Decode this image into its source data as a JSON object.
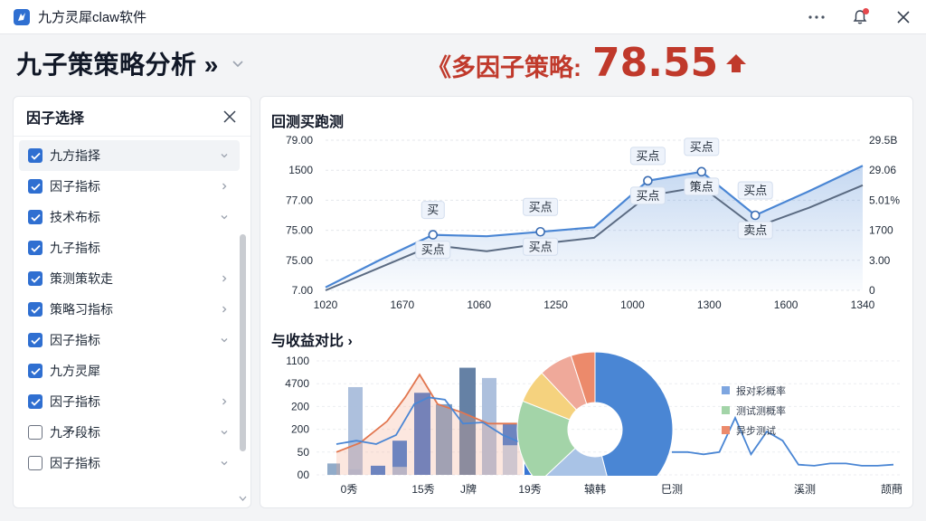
{
  "window": {
    "title": "九方灵犀claw软件"
  },
  "header": {
    "title": "九子策策略分析 »",
    "score_label": "《多因子策略:",
    "score_value": "78.55"
  },
  "factor_panel": {
    "title": "因子选择",
    "items": [
      {
        "label": "九方指择",
        "checked": true,
        "chevron": "down"
      },
      {
        "label": "因子指标",
        "checked": true,
        "chevron": "right"
      },
      {
        "label": "技术布标",
        "checked": true,
        "chevron": "down"
      },
      {
        "label": "九子指标",
        "checked": true,
        "chevron": "none"
      },
      {
        "label": "策测策软走",
        "checked": true,
        "chevron": "right"
      },
      {
        "label": "策略习指标",
        "checked": true,
        "chevron": "right"
      },
      {
        "label": "因子指标",
        "checked": true,
        "chevron": "down"
      },
      {
        "label": "九方灵犀",
        "checked": true,
        "chevron": "none"
      },
      {
        "label": "因子指标",
        "checked": true,
        "chevron": "right"
      },
      {
        "label": "九矛段标",
        "checked": false,
        "chevron": "down"
      },
      {
        "label": "因子指标",
        "checked": false,
        "chevron": "down"
      }
    ]
  },
  "colors": {
    "accent": "#2f6fd1",
    "danger": "#c0392b",
    "line_main": "#4a86d4",
    "line_secondary": "#5b6b82"
  },
  "chart_data": [
    {
      "type": "line",
      "title": "回测买跑测",
      "x": [
        "1020",
        "1670",
        "1060",
        "1250",
        "1000",
        "1300",
        "1600",
        "1340"
      ],
      "y_left_ticks": [
        "79.00",
        "1500",
        "77.00",
        "75.00",
        "75.00",
        "7.00"
      ],
      "y_right_ticks": [
        "29.5B",
        "29.06",
        "5.01%",
        "1700",
        "3.00",
        "0"
      ],
      "grid": true,
      "series": [
        {
          "values": [
            0.02,
            0.2,
            0.37,
            0.36,
            0.39,
            0.42,
            0.73,
            0.79,
            0.5,
            0.66,
            0.83
          ]
        },
        {
          "values": [
            0.0,
            0.15,
            0.3,
            0.26,
            0.31,
            0.35,
            0.63,
            0.69,
            0.42,
            0.55,
            0.7
          ]
        }
      ],
      "annotations": [
        {
          "text": "买",
          "pos": "above"
        },
        {
          "text": "买点",
          "pos": "below"
        },
        {
          "text": "买点",
          "pos": "above"
        },
        {
          "text": "买点",
          "pos": "below"
        },
        {
          "text": "买点",
          "pos": "above"
        },
        {
          "text": "买点",
          "pos": "below"
        },
        {
          "text": "买点",
          "pos": "above"
        },
        {
          "text": "策点",
          "pos": "below"
        },
        {
          "text": "买点",
          "pos": "above"
        },
        {
          "text": "卖点",
          "pos": "below"
        }
      ]
    },
    {
      "type": "bar",
      "title": "与收益对比 ›",
      "y_ticks": [
        "1100",
        "4700",
        "200",
        "200",
        "50",
        "00"
      ],
      "x_labels": [
        "0秀",
        "15秀",
        "J牌",
        "19秀",
        "辕韩",
        "巳测",
        "溪测",
        "颉蔄"
      ],
      "legend": [
        "报对彩概率",
        "测试测概率",
        "异步测试"
      ],
      "legend_position": "right",
      "bars": [
        {
          "value": 0.1,
          "color": "#8ba6c6"
        },
        {
          "value": 0.05,
          "color": "#2f6fd1"
        },
        {
          "value": 0.77,
          "color": "#a9bddb"
        },
        {
          "value": 0.08,
          "color": "#2f6fd1"
        },
        {
          "value": 0.3,
          "color": "#2f6fd1"
        },
        {
          "value": 0.07,
          "color": "#a9bddb"
        },
        {
          "value": 0.72,
          "color": "#3a6cc6"
        },
        {
          "value": 0.62,
          "color": "#7a9ac0"
        },
        {
          "value": 0.94,
          "color": "#5d7aa0"
        },
        {
          "value": 0.85,
          "color": "#a9bddb"
        },
        {
          "value": 0.45,
          "color": "#2f6fd1"
        },
        {
          "value": 0.26,
          "color": "#c8d6ea"
        },
        {
          "value": 0.12,
          "color": "#2f6fd1"
        }
      ],
      "line_orange": [
        0.2,
        0.28,
        0.47,
        0.68,
        0.88,
        0.62,
        0.55,
        0.45,
        0.45
      ],
      "line_blue": [
        0.27,
        0.3,
        0.27,
        0.35,
        0.62,
        0.68,
        0.66,
        0.45,
        0.46,
        0.35,
        0.29,
        0.23
      ],
      "line_blue_tail": [
        0.2,
        0.2,
        0.18,
        0.2,
        0.5,
        0.18,
        0.38,
        0.3,
        0.09,
        0.08,
        0.1,
        0.1,
        0.08,
        0.08,
        0.09
      ],
      "pie": [
        {
          "value": 0.46,
          "color": "#4a86d4"
        },
        {
          "value": 0.17,
          "color": "#a9c3e6"
        },
        {
          "value": 0.18,
          "color": "#a3d4a8"
        },
        {
          "value": 0.07,
          "color": "#f5d27e"
        },
        {
          "value": 0.07,
          "color": "#efa99a"
        },
        {
          "value": 0.05,
          "color": "#ec8a6b"
        }
      ]
    }
  ]
}
